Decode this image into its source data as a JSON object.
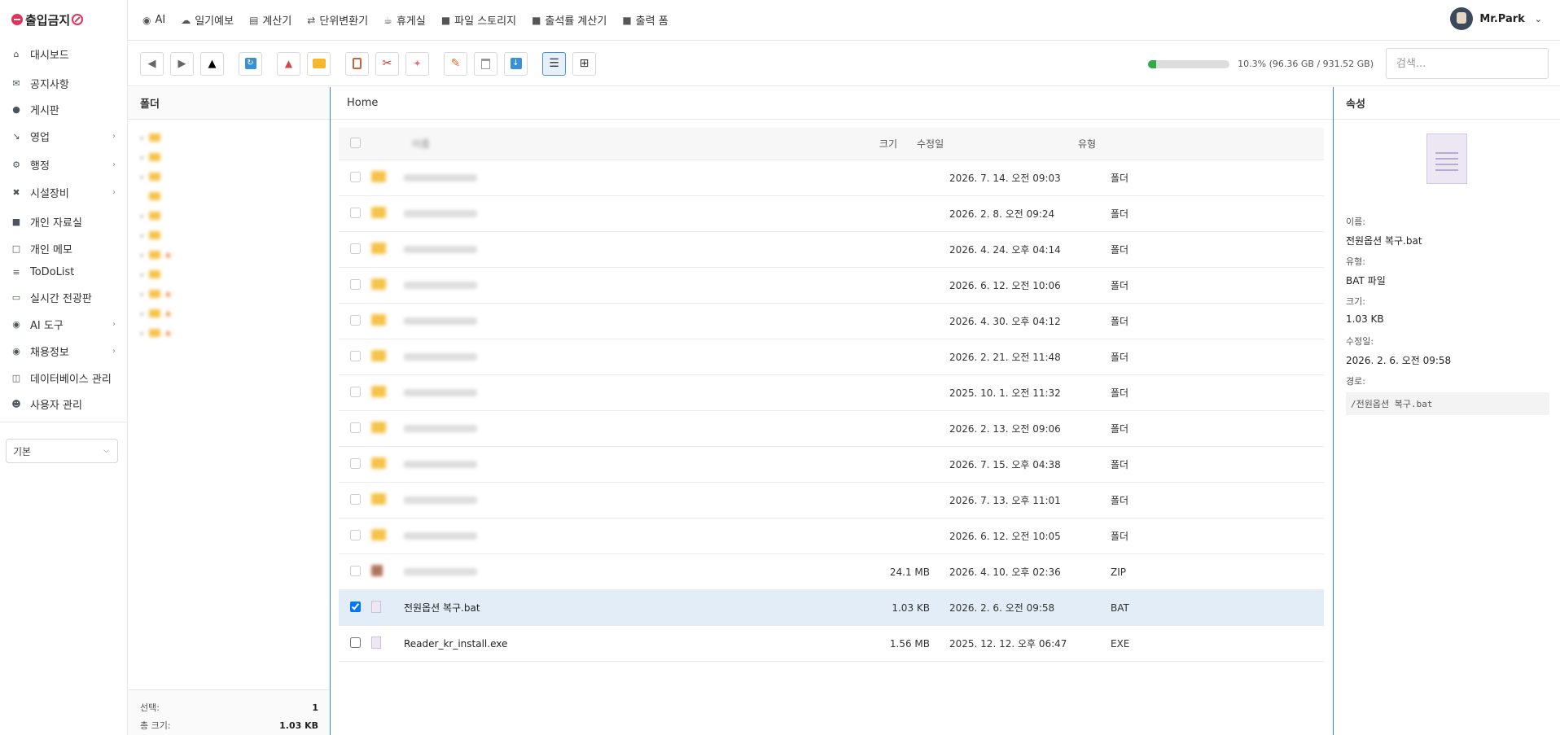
{
  "brand": "출입금지",
  "sidebar": {
    "items": [
      {
        "label": "대시보드",
        "icon": "home-icon",
        "has_sub": false
      },
      {
        "label": "공지사항",
        "icon": "megaphone-icon",
        "has_sub": false
      },
      {
        "label": "게시판",
        "icon": "chat-icon",
        "has_sub": false
      },
      {
        "label": "영업",
        "icon": "chart-icon",
        "has_sub": true
      },
      {
        "label": "행정",
        "icon": "gears-icon",
        "has_sub": true
      },
      {
        "label": "시설장비",
        "icon": "tools-icon",
        "has_sub": true
      },
      {
        "label": "개인 자료실",
        "icon": "folder-icon",
        "has_sub": false
      },
      {
        "label": "개인 메모",
        "icon": "note-icon",
        "has_sub": false
      },
      {
        "label": "ToDoList",
        "icon": "list-icon",
        "has_sub": false
      },
      {
        "label": "실시간 전광판",
        "icon": "monitor-icon",
        "has_sub": false
      },
      {
        "label": "AI 도구",
        "icon": "robot-icon",
        "has_sub": true
      },
      {
        "label": "채용정보",
        "icon": "robot-icon",
        "has_sub": true
      },
      {
        "label": "데이터베이스 관리",
        "icon": "database-icon",
        "has_sub": false
      },
      {
        "label": "사용자 관리",
        "icon": "users-icon",
        "has_sub": false
      }
    ],
    "select_value": "기본"
  },
  "topbar": {
    "links": [
      {
        "label": "AI",
        "icon": "robot-icon"
      },
      {
        "label": "일기예보",
        "icon": "cloud-icon"
      },
      {
        "label": "계산기",
        "icon": "calculator-icon"
      },
      {
        "label": "단위변환기",
        "icon": "exchange-icon"
      },
      {
        "label": "휴게실",
        "icon": "coffee-icon"
      },
      {
        "label": "파일 스토리지",
        "icon": "folder-icon"
      },
      {
        "label": "출석률 계산기",
        "icon": "folder-icon"
      },
      {
        "label": "출력 폼",
        "icon": "folder-icon"
      }
    ],
    "user_name": "Mr.Park"
  },
  "toolbar": {
    "disk_usage_text": "10.3% (96.36 GB / 931.52 GB)",
    "disk_usage_fraction": 0.103,
    "search_placeholder": "검색..."
  },
  "folder_pane": {
    "title": "폴더",
    "selected_label": "선택:",
    "selected_count": "1",
    "total_size_label": "총 크기:",
    "total_size": "1.03 KB"
  },
  "file_pane": {
    "path": "Home",
    "columns": {
      "name": "이름",
      "size": "크기",
      "modified": "수정일",
      "type": "유형"
    },
    "files": [
      {
        "date": "2026. 7. 14. 오전 09:03",
        "type": "폴더"
      },
      {
        "date": "2026. 2. 8. 오전 09:24",
        "type": "폴더"
      },
      {
        "date": "2026. 4. 24. 오후 04:14",
        "type": "폴더"
      },
      {
        "date": "2026. 6. 12. 오전 10:06",
        "type": "폴더"
      },
      {
        "date": "2026. 4. 30. 오후 04:12",
        "type": "폴더"
      },
      {
        "date": "2026. 2. 21. 오전 11:48",
        "type": "폴더"
      },
      {
        "date": "2025. 10. 1. 오전 11:32",
        "type": "폴더"
      },
      {
        "date": "2026. 2. 13. 오전 09:06",
        "type": "폴더"
      },
      {
        "date": "2026. 7. 15. 오후 04:38",
        "type": "폴더"
      },
      {
        "date": "2026. 7. 13. 오후 11:01",
        "type": "폴더"
      },
      {
        "date": "2026. 6. 12. 오전 10:05",
        "type": "폴더"
      },
      {
        "size": "24.1 MB",
        "date": "2026. 4. 10. 오후 02:36",
        "type": "ZIP"
      },
      {
        "name": "전원옵션 복구.bat",
        "size": "1.03 KB",
        "date": "2026. 2. 6. 오전 09:58",
        "type": "BAT",
        "checked": true
      },
      {
        "name": "Reader_kr_install.exe",
        "size": "1.56 MB",
        "date": "2025. 12. 12. 오후 06:47",
        "type": "EXE",
        "checked": false
      }
    ]
  },
  "properties": {
    "title": "속성",
    "name_label": "이름:",
    "name": "전원옵션 복구.bat",
    "type_label": "유형:",
    "type": "BAT 파일",
    "size_label": "크기:",
    "size": "1.03 KB",
    "modified_label": "수정일:",
    "modified": "2026. 2. 6. 오전 09:58",
    "path_label": "경로:",
    "path": "/전원옵션 복구.bat"
  }
}
